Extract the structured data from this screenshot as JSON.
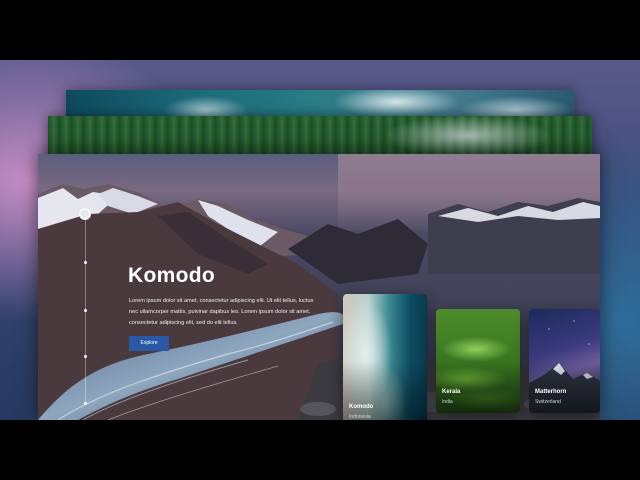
{
  "hero": {
    "title": "Komodo",
    "description": "Lorem ipsum dolor sit amet, consectetur adipiscing elit. Ut elit tellus, luctus nec ullamcorper mattis, pulvinar dapibus leo. Lorem ipsum dolor sit amet, consectetur adipiscing elit, sed do elit tellus.",
    "button_label": "Explore"
  },
  "cards": [
    {
      "name": "Komodo",
      "place": "Indonesia"
    },
    {
      "name": "Kerala",
      "place": "India"
    },
    {
      "name": "Matterhorn",
      "place": "Switzerland"
    }
  ],
  "nav": {
    "prev_icon": "arrow-left-icon",
    "next_icon": "arrow-right-icon"
  },
  "colors": {
    "accent": "#2a58a6",
    "background": "#3c4a78"
  },
  "timeline": {
    "icons": [
      "timeline-knob",
      "timeline-dot"
    ]
  }
}
